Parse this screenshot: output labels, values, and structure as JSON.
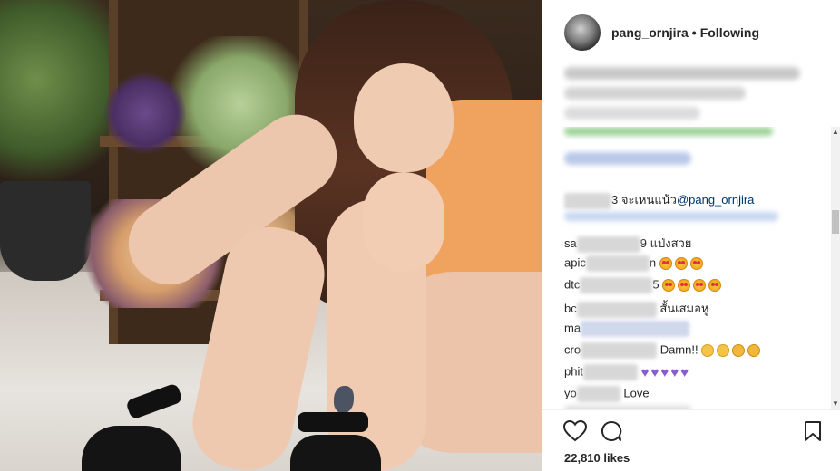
{
  "post": {
    "username": "pang_ornjira",
    "separator": "•",
    "follow_status": "Following",
    "likes_text": "22,810 likes"
  },
  "comments": [
    {
      "prefix": "",
      "name_suffix": "3",
      "text": "จะเหนแน้ว",
      "mention": "@pang_ornjira"
    },
    {
      "prefix": "sa",
      "name_suffix": "9",
      "text": "แป่งสวย"
    },
    {
      "prefix": "apic",
      "name_suffix": "n",
      "emojis": [
        "heart-eyes",
        "heart-eyes",
        "heart-eyes"
      ]
    },
    {
      "prefix": "dtc",
      "name_suffix": "5",
      "emojis": [
        "heart-eyes",
        "heart-eyes",
        "heart-eyes",
        "heart-eyes"
      ]
    },
    {
      "prefix": "bc",
      "name_suffix": "",
      "text": "สั้นเสมอหู"
    },
    {
      "prefix": "ma",
      "name_suffix": "",
      "text": ""
    },
    {
      "prefix": "cro",
      "name_suffix": "",
      "text": "Damn!!",
      "emojis": [
        "neutral",
        "neutral",
        "rofl",
        "rofl"
      ]
    },
    {
      "prefix": "phit",
      "name_suffix": "",
      "hearts": 5
    },
    {
      "prefix": "yo",
      "name_suffix": "",
      "text": "Love"
    }
  ],
  "icons": {
    "like": "heart-outline-icon",
    "comment": "speech-bubble-icon",
    "save": "bookmark-icon"
  },
  "colors": {
    "text": "#262626",
    "mention": "#003569",
    "heart_emoji": "#8a5cd1"
  }
}
